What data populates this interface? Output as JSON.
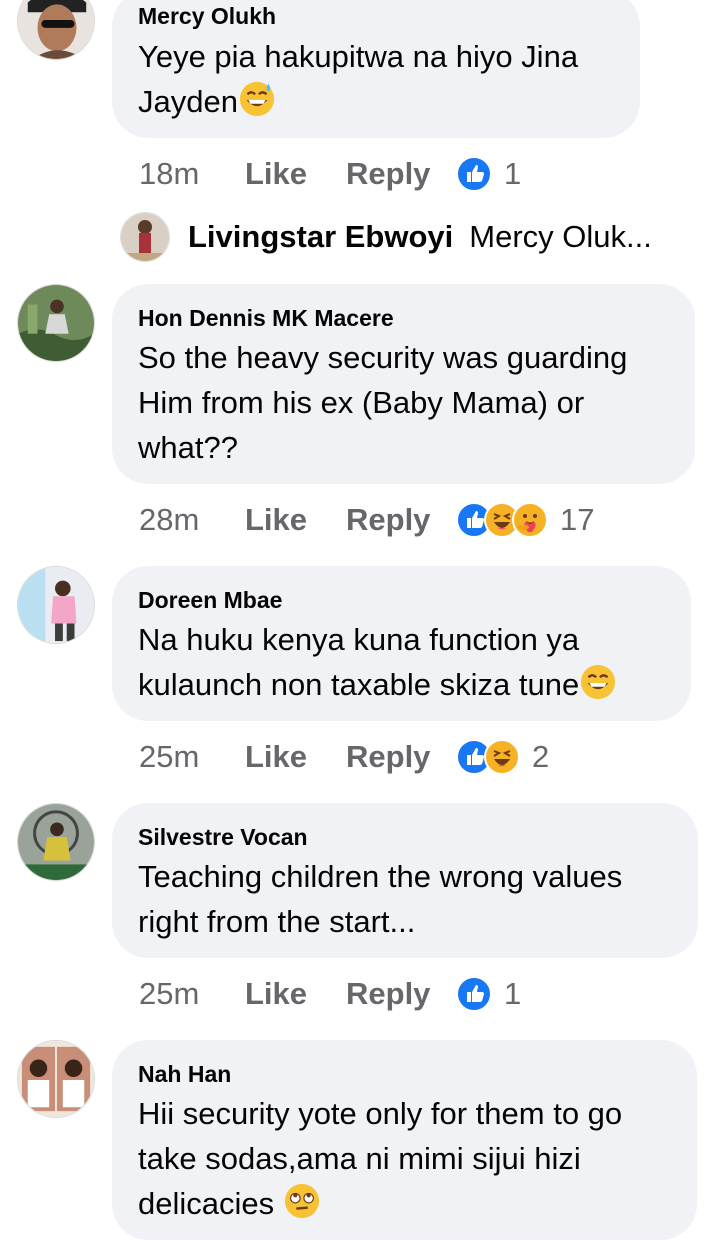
{
  "comments": [
    {
      "author": "Mercy Olukh",
      "text": "Yeye pia hakupitwa na hiyo Jina\nJayden",
      "emoji": "grinning-sweat-emoji",
      "time": "18m",
      "like_label": "Like",
      "reply_label": "Reply",
      "reactions": [
        "like"
      ],
      "reaction_count": "1"
    },
    {
      "author": "Hon Dennis MK Macere",
      "text": "So the heavy security was guarding\nHim from his ex (Baby Mama) or\nwhat??",
      "time": "28m",
      "like_label": "Like",
      "reply_label": "Reply",
      "reactions": [
        "like",
        "haha",
        "care"
      ],
      "reaction_count": "17"
    },
    {
      "author": "Doreen Mbae",
      "text": "Na huku kenya kuna function ya\nkulaunch non taxable skiza tune",
      "emoji": "grinning-emoji",
      "time": "25m",
      "like_label": "Like",
      "reply_label": "Reply",
      "reactions": [
        "like",
        "haha"
      ],
      "reaction_count": "2"
    },
    {
      "author": "Silvestre Vocan",
      "text": "Teaching children the wrong values\nright from the start...",
      "time": "25m",
      "like_label": "Like",
      "reply_label": "Reply",
      "reactions": [
        "like"
      ],
      "reaction_count": "1"
    },
    {
      "author": "Nah Han",
      "text": "Hii security yote only for them to go\ntake sodas,ama ni mimi sijui hizi\ndelicacies",
      "emoji": "rolling-eyes-emoji",
      "time": "",
      "like_label": "",
      "reply_label": "",
      "reactions": [],
      "reaction_count": ""
    }
  ],
  "reply_preview": {
    "author": "Livingstar Ebwoyi",
    "text": "Mercy Oluk..."
  },
  "colors": {
    "bubble": "#f0f2f5",
    "meta": "#65676b",
    "like_blue": "#1877f2",
    "emoji_yellow": "#f7b125"
  }
}
